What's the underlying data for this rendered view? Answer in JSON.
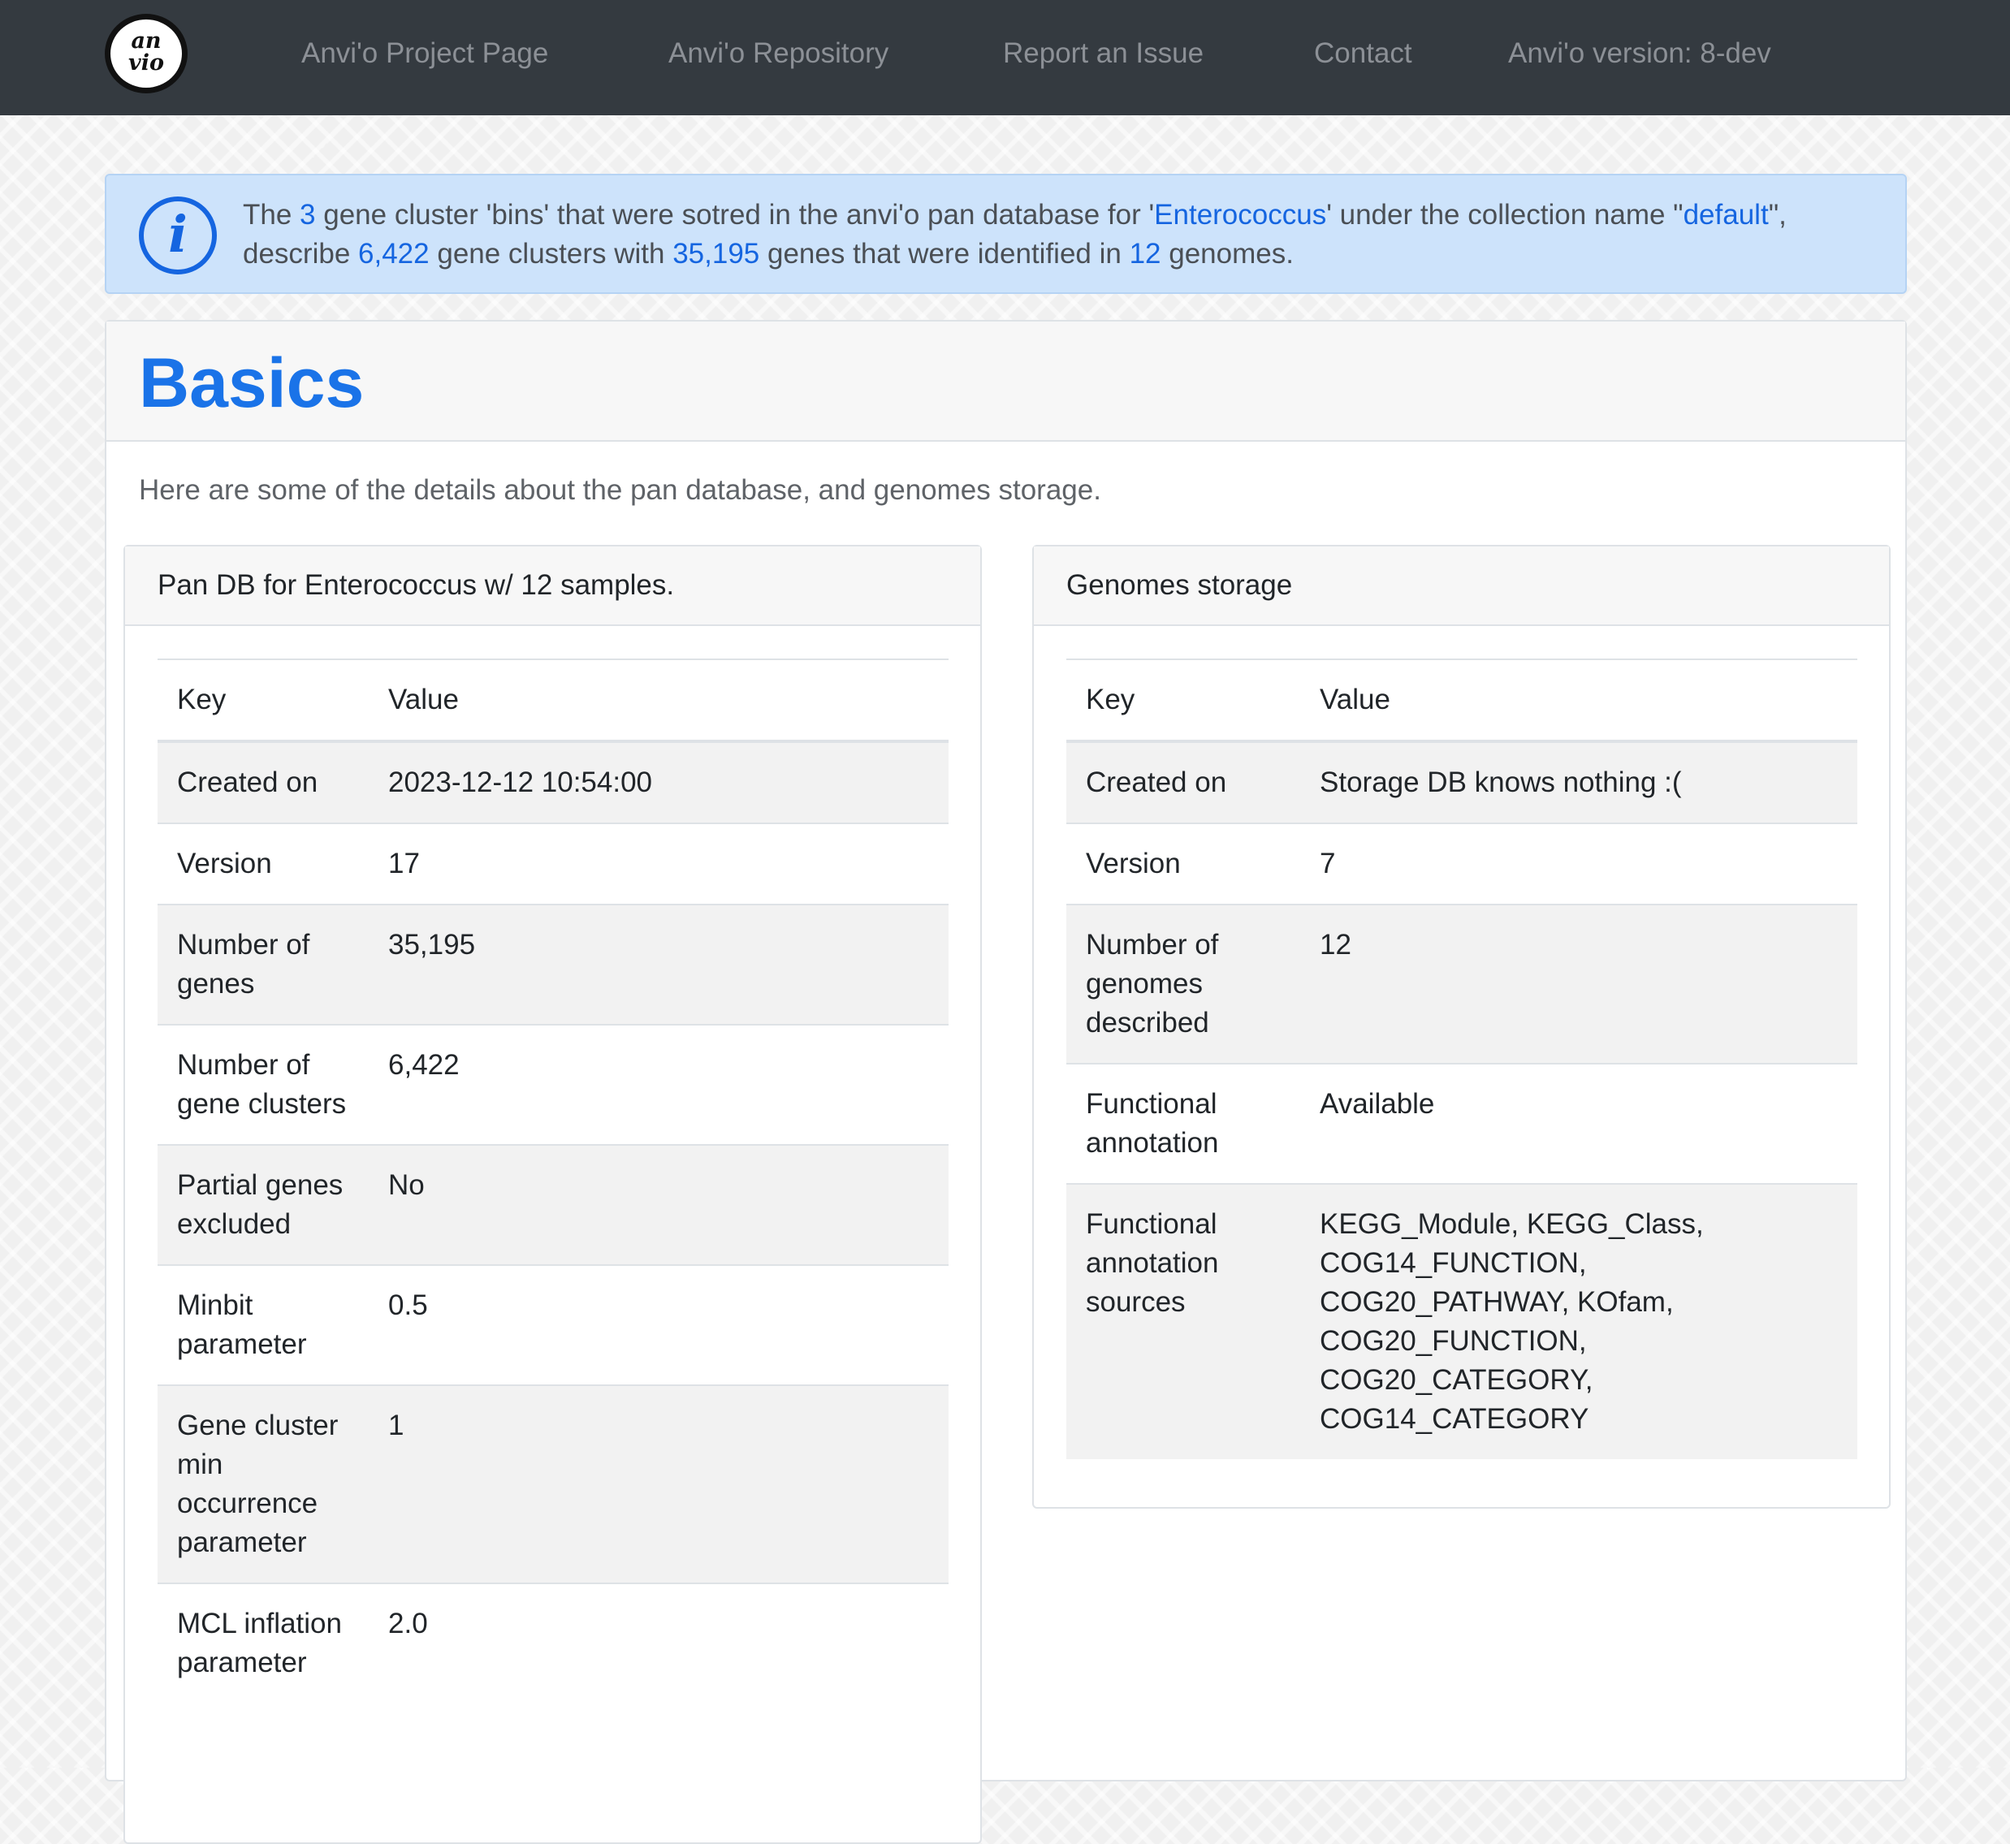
{
  "logo": {
    "line1": "an",
    "line2": "vio"
  },
  "nav": {
    "links": [
      "Anvi'o Project Page",
      "Anvi'o Repository",
      "Report an Issue",
      "Contact",
      "Anvi'o version: 8-dev"
    ]
  },
  "alert": {
    "icon": "info-icon",
    "parts": [
      "The ",
      "3",
      " gene cluster 'bins' that were sotred in the anvi'o pan database for '",
      "Enterococcus",
      "' under the collection name \"",
      "default",
      "\", describe ",
      "6,422",
      " gene clusters with ",
      "35,195",
      " genes that were identified in ",
      "12",
      " genomes."
    ]
  },
  "basics": {
    "title": "Basics",
    "intro": "Here are some of the details about the pan database, and genomes storage."
  },
  "pan_db": {
    "title": "Pan DB for Enterococcus w/ 12 samples.",
    "header_key": "Key",
    "header_value": "Value",
    "rows": [
      {
        "key": "Created on",
        "value": "2023-12-12 10:54:00"
      },
      {
        "key": "Version",
        "value": "17"
      },
      {
        "key": "Number of genes",
        "value": "35,195"
      },
      {
        "key": "Number of gene clusters",
        "value": "6,422"
      },
      {
        "key": "Partial genes excluded",
        "value": "No"
      },
      {
        "key": "Minbit parameter",
        "value": "0.5"
      },
      {
        "key": "Gene cluster min occurrence parameter",
        "value": "1"
      },
      {
        "key": "MCL inflation parameter",
        "value": "2.0"
      }
    ]
  },
  "genomes_storage": {
    "title": "Genomes storage",
    "header_key": "Key",
    "header_value": "Value",
    "rows": [
      {
        "key": "Created on",
        "value": "Storage DB knows nothing :("
      },
      {
        "key": "Version",
        "value": "7"
      },
      {
        "key": "Number of genomes described",
        "value": "12"
      },
      {
        "key": "Functional annotation",
        "value": "Available"
      },
      {
        "key": "Functional annotation sources",
        "value": "KEGG_Module, KEGG_Class, COG14_FUNCTION, COG20_PATHWAY, KOfam, COG20_FUNCTION, COG20_CATEGORY, COG14_CATEGORY"
      }
    ]
  },
  "colors": {
    "navbar": "#343a40",
    "nav_link": "#8c9096",
    "accent": "#1a73e8",
    "alert_bg": "#cde3fb"
  }
}
